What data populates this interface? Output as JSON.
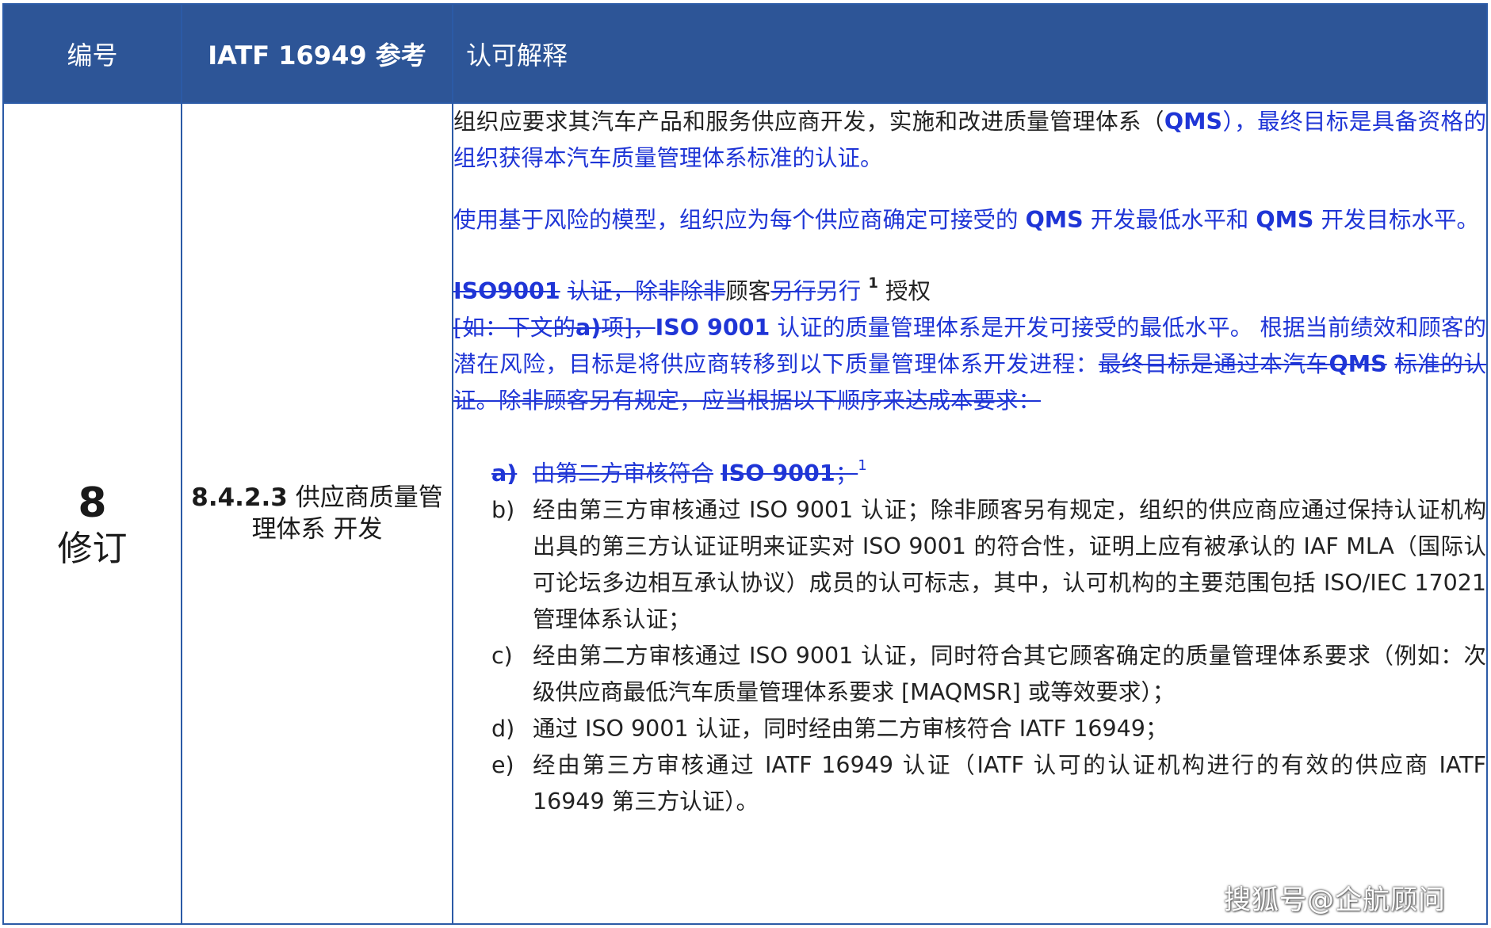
{
  "header": {
    "col1": "编号",
    "col2": "IATF 16949 参考",
    "col3": "认可解释"
  },
  "row": {
    "number": "8",
    "number_label": "修订",
    "ref_code": "8.4.2.3",
    "ref_title": "供应商质量管理体系 开发",
    "p1_a": "组织应要求其汽车产品和服务供应商开发，实施和改进质量管理体系（",
    "p1_b": "QMS",
    "p1_c": "），最终目标是具备资格的组织获得本汽车质量管理体系标准的认证。",
    "p2_a": "使用基于风险的模型，组织应为每个供应商确定可接受的",
    "p2_b": "QMS",
    "p2_c": "开发最低水平和",
    "p2_d": "QMS",
    "p2_e": "开发目标水平。",
    "p3_del1": "ISO9001",
    "p3_del2": "认证，除非除非",
    "p3_keep1": "顾客",
    "p3_del3": "另行",
    "p3_ins1": "另行",
    "p3_sup": "1",
    "p3_keep2": "授权",
    "p4_del1": "[如：下文的",
    "p4_del2": "a)",
    "p4_del3": "项]，",
    "p4_b1": "ISO 9001",
    "p4_ins1": "认证的质量管理体系是开发可接受的最低水平。 根据当前绩效和顾客的潜在风险，目标是将供应商转移到以下质量管理体系开发进程：",
    "p4_del4": "最终目标是通过本汽车",
    "p4_del5": "QMS",
    "p4_del6": "标准的认证。除非顾客另有规定，应当根据以下顺序来达成本要求：",
    "item_a_marker": "a)",
    "item_a_text1": "由第二方审核符合",
    "item_a_text2": "ISO 9001",
    "item_a_text3": "；",
    "item_a_sup": "1",
    "item_b_marker": "b)",
    "item_b_text": "经由第三方审核通过 ISO 9001 认证；除非顾客另有规定，组织的供应商应通过保持认证机构出具的第三方认证证明来证实对 ISO 9001 的符合性，证明上应有被承认的 IAF MLA（国际认可论坛多边相互承认协议）成员的认可标志，其中，认可机构的主要范围包括 ISO/IEC 17021 管理体系认证；",
    "item_c_marker": "c)",
    "item_c_text": "经由第二方审核通过 ISO 9001 认证，同时符合其它顾客确定的质量管理体系要求（例如：次级供应商最低汽车质量管理体系要求 [MAQMSR] 或等效要求）；",
    "item_d_marker": "d)",
    "item_d_text": "通过 ISO 9001 认证，同时经由第二方审核符合 IATF 16949；",
    "item_e_marker": "e)",
    "item_e_text": "经由第三方审核通过 IATF 16949 认证（IATF 认可的认证机构进行的有效的供应商 IATF 16949 第三方认证）。"
  },
  "watermark": "搜狐号@企航顾问",
  "colors": {
    "header_bg": "#2d5597",
    "border": "#2b5aa6",
    "revision_blue": "#1f35d6"
  }
}
